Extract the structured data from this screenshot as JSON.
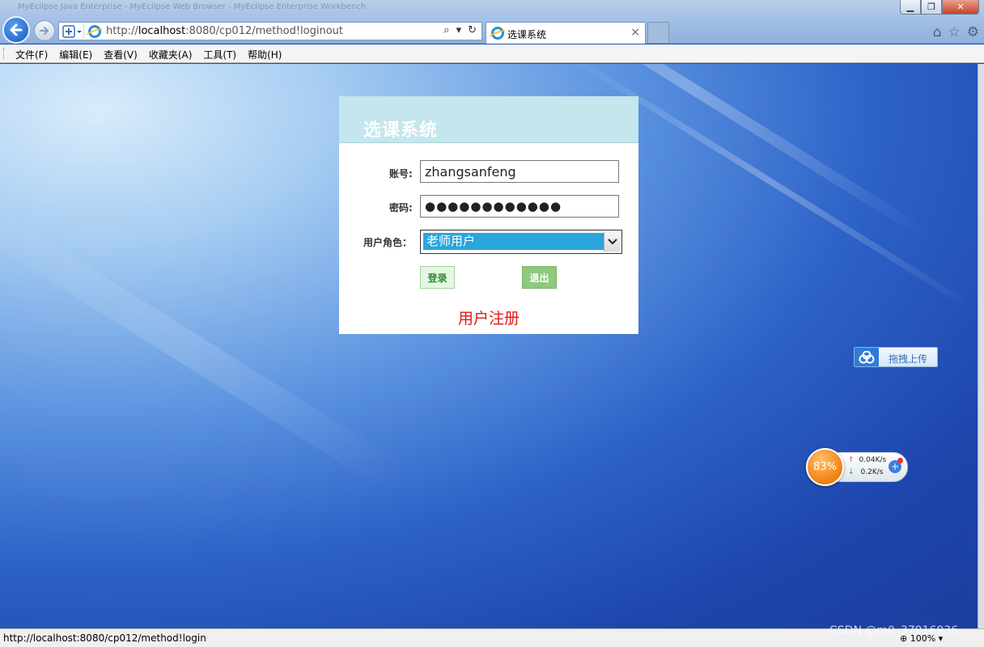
{
  "window": {
    "title_faint": "MyEclipse Java Enterprise - MyEclipse Web Browser - MyEclipse Enterprise Workbench",
    "buttons": {
      "minimize": "▁",
      "maximize": "❐",
      "close": "✕"
    }
  },
  "address_bar": {
    "url_prefix": "http://",
    "url_host": "localhost",
    "url_rest": ":8080/cp012/method!loginout",
    "search_icon": "search-icon",
    "refresh_icon": "refresh-icon"
  },
  "tab": {
    "title": "选课系统",
    "close": "×"
  },
  "menu": [
    "文件(F)",
    "编辑(E)",
    "查看(V)",
    "收藏夹(A)",
    "工具(T)",
    "帮助(H)"
  ],
  "login": {
    "title": "选课系统",
    "account_label": "账号:",
    "account_value": "zhangsanfeng",
    "password_label": "密码:",
    "password_mask": "●●●●●●●●●●●●",
    "role_label": "用户角色：",
    "role_selected": "老师用户",
    "login_button": "登录",
    "exit_button": "退出",
    "register_link": "用户注册"
  },
  "upload_widget": {
    "label": "拖拽上传"
  },
  "speed_widget": {
    "percent": "83%",
    "up": "0.04K/s",
    "down": "0.2K/s"
  },
  "status": {
    "text": "http://localhost:8080/cp012/method!login",
    "zoom": "100%"
  },
  "watermark": "CSDN @m0_37916936"
}
